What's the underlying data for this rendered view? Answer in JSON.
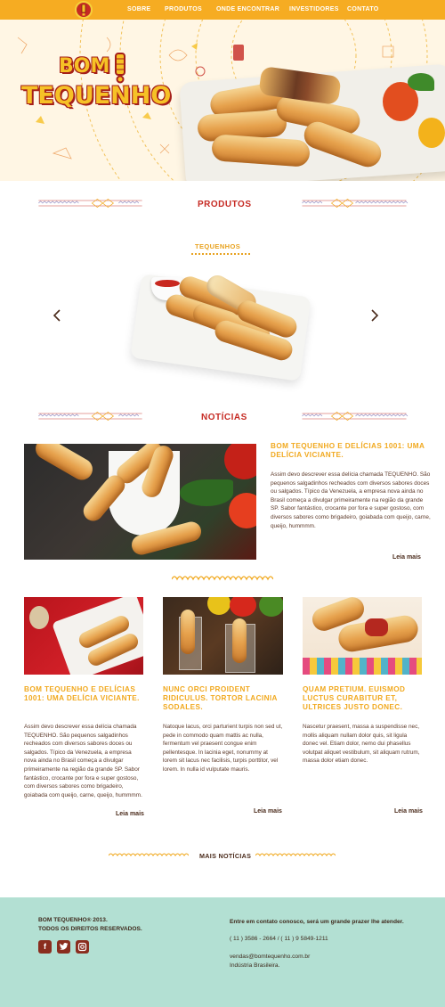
{
  "nav": {
    "items": [
      {
        "label": "SOBRE"
      },
      {
        "label": "PRODUTOS"
      },
      {
        "label": "ONDE ENCONTRAR"
      },
      {
        "label": "INVESTIDORES"
      },
      {
        "label": "CONTATO"
      }
    ]
  },
  "hero": {
    "logo_line1": "BOM",
    "logo_line2": "TEQUENHO"
  },
  "products": {
    "section_title": "PRODUTOS",
    "current_product": "TEQUENHOS",
    "prev_icon": "chevron-left-icon",
    "next_icon": "chevron-right-icon"
  },
  "news": {
    "section_title": "NOTÍCIAS",
    "featured": {
      "title": "BOM TEQUENHO E DELÍCIAS 1001: UMA DELÍCIA VICIANTE.",
      "body": "Assim devo descrever essa delícia chamada TEQUENHO. São pequenos salgadinhos recheados com diversos sabores doces ou salgados. Típico da Venezuela, a empresa nova ainda no Brasil começa a divulgar primeiramente na região da grande SP. Sabor fantástico, crocante por fora e super gostoso, com diversos sabores como brigadeiro, goiabada com queijo, carne, queijo, hummmm.",
      "link": "Leia mais"
    },
    "cards": [
      {
        "title": "BOM TEQUENHO E DELÍCIAS 1001: UMA DELÍCIA VICIANTE.",
        "body": "Assim devo descrever essa delícia chamada TEQUENHO. São pequenos salgadinhos recheados com diversos sabores doces ou salgados. Típico da Venezuela, a empresa nova ainda no Brasil começa a divulgar primeiramente na região da grande SP. Sabor fantástico, crocante por fora e super gostoso, com diversos sabores como brigadeiro, goiabada com queijo, carne, queijo, hummmm.",
        "link": "Leia mais"
      },
      {
        "title": "NUNC ORCI PROIDENT RIDICULUS. TORTOR LACINIA SODALES.",
        "body": "Natoque lacus, orci parturient turpis non sed ut, pede in commodo quam mattis ac nulla, fermentum vel praesent congue enim pellentesque. In lacinia eget, nonummy at lorem sit lacus nec facilisis, turpis porttitor, vel lorem. In nulla id vulputate mauris.",
        "link": "Leia mais"
      },
      {
        "title": "QUAM PRETIUM. EUISMOD LUCTUS CURABITUR ET, ULTRICES JUSTO DONEC.",
        "body": "Nascetur praesent, massa a suspendisse nec, mollis aliquam nullam dolor quis, sit ligula donec vel. Etiam dolor, nemo dui phasellus volutpat aliquet vestibulum, sit aliquam rutrum, massa dolor etiam donec.",
        "link": "Leia mais"
      }
    ],
    "more_link": "MAIS NOTÍCIAS"
  },
  "footer": {
    "copyright_line1": "BOM TEQUENHO® 2013.",
    "copyright_line2": "TODOS OS DIREITOS RESERVADOS.",
    "social_icons": [
      "facebook-icon",
      "twitter-icon",
      "instagram-icon"
    ],
    "contact_intro": "Entre em contato conosco, será um grande prazer lhe atender.",
    "phones": "( 11 ) 3586 - 2664 / ( 11 ) 9 5849-1211",
    "email": "vendas@bomtequenho.com.br",
    "origin": "Indústria Brasileira."
  },
  "colors": {
    "nav_bg": "#f6ac22",
    "brand_red": "#c62a23",
    "accent_yellow": "#f1a91f",
    "footer_bg": "#b3e0d3",
    "text_brown": "#5e3b2b"
  }
}
